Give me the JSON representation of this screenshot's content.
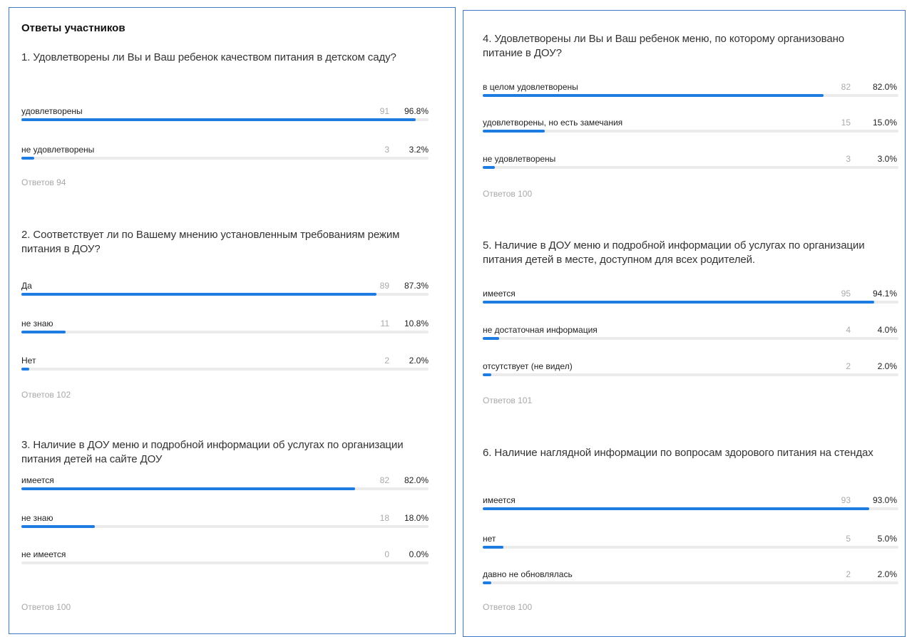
{
  "left_panel": {
    "title": "Ответы участников",
    "questions": [
      {
        "text": "1. Удовлетворены ли Вы и Ваш ребенок качеством питания в детском саду?",
        "options": [
          {
            "label": "удовлетворены",
            "count": "91",
            "percent": "96.8%",
            "fraction": 0.968
          },
          {
            "label": "не удовлетворены",
            "count": "3",
            "percent": "3.2%",
            "fraction": 0.032
          }
        ],
        "answers": "Ответов 94"
      },
      {
        "text": "2. Соответствует ли по Вашему мнению установленным требованиям режим питания в ДОУ?",
        "options": [
          {
            "label": "Да",
            "count": "89",
            "percent": "87.3%",
            "fraction": 0.873
          },
          {
            "label": "не знаю",
            "count": "11",
            "percent": "10.8%",
            "fraction": 0.108
          },
          {
            "label": "Нет",
            "count": "2",
            "percent": "2.0%",
            "fraction": 0.02
          }
        ],
        "answers": "Ответов 102"
      },
      {
        "text": "3. Наличие в ДОУ меню и подробной информации об услугах по организации питания детей на сайте ДОУ",
        "options": [
          {
            "label": "имеется",
            "count": "82",
            "percent": "82.0%",
            "fraction": 0.82
          },
          {
            "label": "не знаю",
            "count": "18",
            "percent": "18.0%",
            "fraction": 0.18
          },
          {
            "label": "не имеется",
            "count": "0",
            "percent": "0.0%",
            "fraction": 0.0
          }
        ],
        "answers": "Ответов 100"
      }
    ]
  },
  "right_panel": {
    "questions": [
      {
        "text": "4. Удовлетворены ли Вы и Ваш ребенок меню, по которому организовано питание в ДОУ?",
        "options": [
          {
            "label": "в целом удовлетворены",
            "count": "82",
            "percent": "82.0%",
            "fraction": 0.82
          },
          {
            "label": "удовлетворены, но есть замечания",
            "count": "15",
            "percent": "15.0%",
            "fraction": 0.15
          },
          {
            "label": "не удовлетворены",
            "count": "3",
            "percent": "3.0%",
            "fraction": 0.03
          }
        ],
        "answers": "Ответов 100"
      },
      {
        "text": "5. Наличие в ДОУ меню и подробной информации об услугах по организации питания детей в месте, доступном для всех родителей.",
        "options": [
          {
            "label": "имеется",
            "count": "95",
            "percent": "94.1%",
            "fraction": 0.941
          },
          {
            "label": "не достаточная информация",
            "count": "4",
            "percent": "4.0%",
            "fraction": 0.04
          },
          {
            "label": "отсутствует (не видел)",
            "count": "2",
            "percent": "2.0%",
            "fraction": 0.02
          }
        ],
        "answers": "Ответов 101"
      },
      {
        "text": "6. Наличие наглядной информации по вопросам здорового питания на стендах",
        "options": [
          {
            "label": "имеется",
            "count": "93",
            "percent": "93.0%",
            "fraction": 0.93
          },
          {
            "label": "нет",
            "count": "5",
            "percent": "5.0%",
            "fraction": 0.05
          },
          {
            "label": "давно не обновлялась",
            "count": "2",
            "percent": "2.0%",
            "fraction": 0.02
          }
        ],
        "answers": "Ответов 100"
      }
    ]
  },
  "colors": {
    "bar_fill": "#1d7ce2",
    "bar_track": "#ebebeb",
    "panel_border": "#3c7ac9"
  }
}
